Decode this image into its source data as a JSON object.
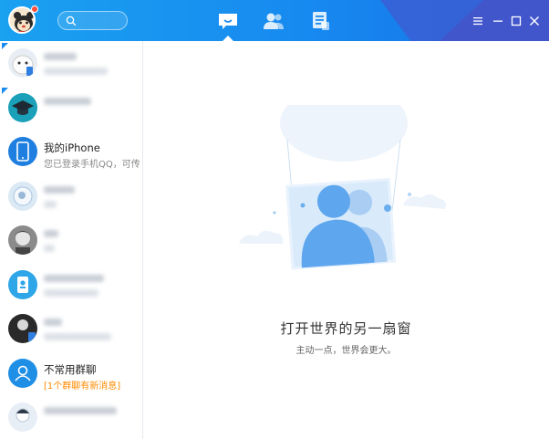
{
  "nav": {
    "tabs": [
      {
        "icon": "message-icon",
        "active": true
      },
      {
        "icon": "contacts-icon",
        "active": false
      },
      {
        "icon": "apps-icon",
        "active": false
      }
    ]
  },
  "colors": {
    "titlebar": "#178af0",
    "accent": "#1a8cf0",
    "notify": "#ff4c3b",
    "orange_text": "#ff8a00"
  },
  "sidebar": {
    "items": [
      {
        "name": "",
        "sub": "",
        "blurred": true,
        "pinned": true,
        "avatar": "bear-avatar"
      },
      {
        "name": "",
        "sub": "",
        "blurred": true,
        "pinned": true,
        "avatar": "graduation-cap-avatar"
      },
      {
        "name": "我的iPhone",
        "sub": "您已登录手机QQ，可传",
        "blurred": false,
        "avatar": "iphone-avatar"
      },
      {
        "name": "",
        "sub": "",
        "blurred": true,
        "avatar": "bird-avatar"
      },
      {
        "name": "",
        "sub": "",
        "blurred": true,
        "avatar": "anime-avatar"
      },
      {
        "name": "",
        "sub": "",
        "blurred": true,
        "avatar": "id-card-avatar"
      },
      {
        "name": "",
        "sub": "",
        "blurred": true,
        "avatar": "photo-avatar"
      },
      {
        "name": "不常用群聊",
        "sub": "[1个群聊有新消息]",
        "blurred": false,
        "sub_orange": true,
        "avatar": "group-avatar"
      },
      {
        "name": "",
        "sub": "",
        "blurred": true,
        "avatar": "cartoon-avatar"
      }
    ]
  },
  "main": {
    "title": "打开世界的另一扇窗",
    "subtitle": "主动一点，世界会更大。"
  }
}
